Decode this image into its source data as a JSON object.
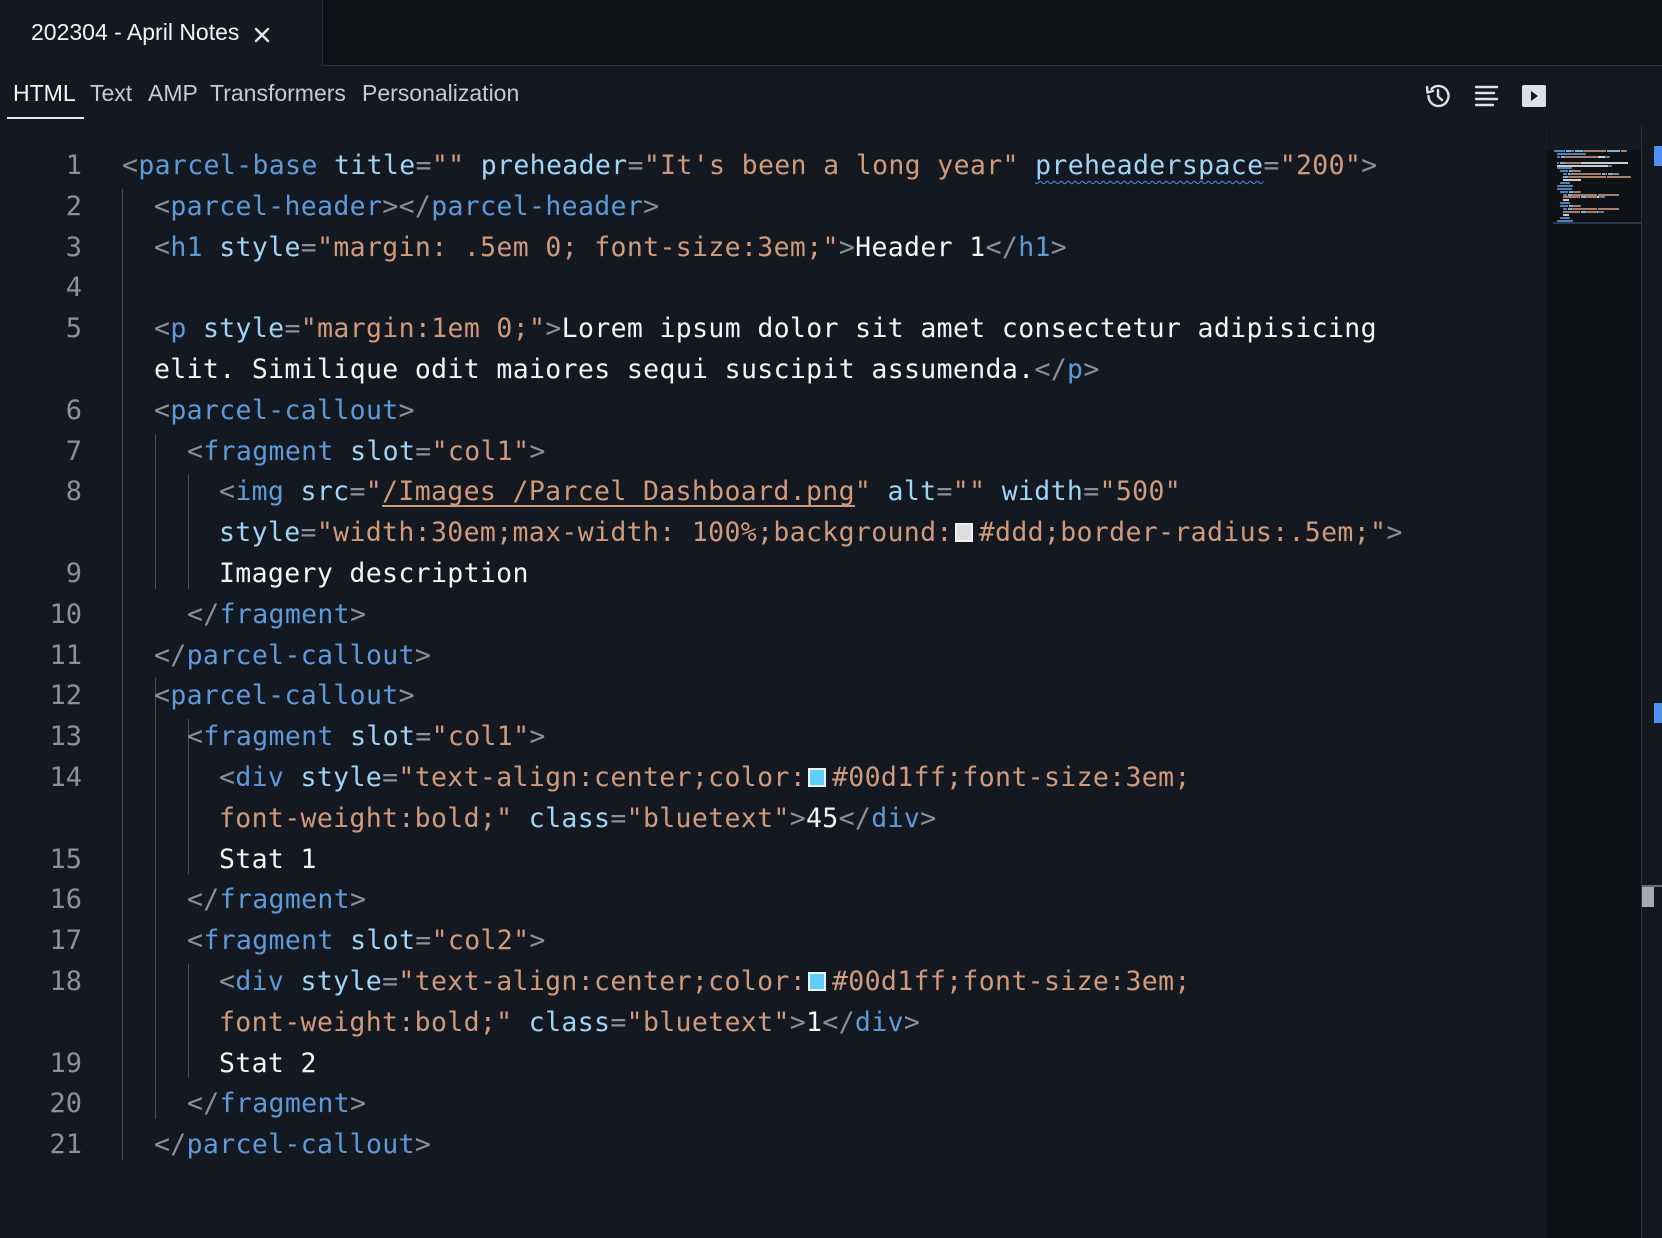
{
  "window": {
    "file_tab": {
      "title": "202304 - April Notes",
      "close_icon": "close-icon"
    }
  },
  "toolbar": {
    "tabs": [
      {
        "label": "HTML",
        "active": true
      },
      {
        "label": "Text",
        "active": false
      },
      {
        "label": "AMP",
        "active": false
      },
      {
        "label": "Transformers",
        "active": false
      },
      {
        "label": "Personalization",
        "active": false
      }
    ],
    "actions": [
      {
        "icon": "history-icon",
        "label": "History"
      },
      {
        "icon": "format-icon",
        "label": "Format"
      },
      {
        "icon": "preview-icon",
        "label": "Preview"
      }
    ]
  },
  "colors": {
    "swatch_ddd": "#dddddd",
    "swatch_00d1ff": "#5ccfff",
    "accent": "#4f8ff0"
  },
  "editor": {
    "gutter": [
      "1",
      "2",
      "3",
      "4",
      "5",
      "",
      "6",
      "7",
      "8",
      "",
      "9",
      "10",
      "11",
      "12",
      "13",
      "14",
      "",
      "15",
      "16",
      "17",
      "18",
      "",
      "19",
      "20",
      "21"
    ],
    "lines": [
      [
        [
          "p",
          "<"
        ],
        [
          "g",
          "parcel-base"
        ],
        [
          "x",
          " "
        ],
        [
          "a",
          "title"
        ],
        [
          "e",
          "="
        ],
        [
          "s",
          "\"\""
        ],
        [
          "x",
          " "
        ],
        [
          "a",
          "preheader"
        ],
        [
          "e",
          "="
        ],
        [
          "s",
          "\"It's been a long year\""
        ],
        [
          "x",
          " "
        ],
        [
          "aw",
          "preheaderspace"
        ],
        [
          "e",
          "="
        ],
        [
          "s",
          "\"200\""
        ],
        [
          "p",
          ">"
        ]
      ],
      [
        [
          "p",
          "<"
        ],
        [
          "g",
          "parcel-header"
        ],
        [
          "p",
          "></"
        ],
        [
          "g",
          "parcel-header"
        ],
        [
          "p",
          ">"
        ]
      ],
      [
        [
          "p",
          "<"
        ],
        [
          "g",
          "h1"
        ],
        [
          "x",
          " "
        ],
        [
          "a",
          "style"
        ],
        [
          "e",
          "="
        ],
        [
          "s",
          "\"margin: .5em 0; font-size:3em;\""
        ],
        [
          "p",
          ">"
        ],
        [
          "t",
          "Header 1"
        ],
        [
          "p",
          "</"
        ],
        [
          "g",
          "h1"
        ],
        [
          "p",
          ">"
        ]
      ],
      [],
      [
        [
          "p",
          "<"
        ],
        [
          "g",
          "p"
        ],
        [
          "x",
          " "
        ],
        [
          "a",
          "style"
        ],
        [
          "e",
          "="
        ],
        [
          "s",
          "\"margin:1em 0;\""
        ],
        [
          "p",
          ">"
        ],
        [
          "t",
          "Lorem ipsum dolor sit amet consectetur adipisicing"
        ]
      ],
      [
        [
          "t",
          "elit. Similique odit maiores sequi suscipit assumenda."
        ],
        [
          "p",
          "</"
        ],
        [
          "g",
          "p"
        ],
        [
          "p",
          ">"
        ]
      ],
      [
        [
          "p",
          "<"
        ],
        [
          "g",
          "parcel-callout"
        ],
        [
          "p",
          ">"
        ]
      ],
      [
        [
          "p",
          "<"
        ],
        [
          "g",
          "fragment"
        ],
        [
          "x",
          " "
        ],
        [
          "a",
          "slot"
        ],
        [
          "e",
          "="
        ],
        [
          "s",
          "\"col1\""
        ],
        [
          "p",
          ">"
        ]
      ],
      [
        [
          "p",
          "<"
        ],
        [
          "g",
          "img"
        ],
        [
          "x",
          " "
        ],
        [
          "a",
          "src"
        ],
        [
          "e",
          "="
        ],
        [
          "s",
          "\""
        ],
        [
          "sl",
          "/Images /Parcel Dashboard.png"
        ],
        [
          "s",
          "\""
        ],
        [
          "x",
          " "
        ],
        [
          "a",
          "alt"
        ],
        [
          "e",
          "="
        ],
        [
          "s",
          "\"\""
        ],
        [
          "x",
          " "
        ],
        [
          "a",
          "width"
        ],
        [
          "e",
          "="
        ],
        [
          "s",
          "\"500\""
        ]
      ],
      [
        [
          "a",
          "style"
        ],
        [
          "e",
          "="
        ],
        [
          "s",
          "\"width:30em;max-width: 100%;background:"
        ],
        [
          "sw",
          "#dddddd"
        ],
        [
          "s",
          "#ddd;border-radius:.5em;\""
        ],
        [
          "p",
          ">"
        ]
      ],
      [
        [
          "t",
          "Imagery description"
        ]
      ],
      [
        [
          "p",
          "</"
        ],
        [
          "g",
          "fragment"
        ],
        [
          "p",
          ">"
        ]
      ],
      [
        [
          "p",
          "</"
        ],
        [
          "g",
          "parcel-callout"
        ],
        [
          "p",
          ">"
        ]
      ],
      [
        [
          "p",
          "<"
        ],
        [
          "g",
          "parcel-callout"
        ],
        [
          "p",
          ">"
        ]
      ],
      [
        [
          "p",
          "<"
        ],
        [
          "g",
          "fragment"
        ],
        [
          "x",
          " "
        ],
        [
          "a",
          "slot"
        ],
        [
          "e",
          "="
        ],
        [
          "s",
          "\"col1\""
        ],
        [
          "p",
          ">"
        ]
      ],
      [
        [
          "p",
          "<"
        ],
        [
          "g",
          "div"
        ],
        [
          "x",
          " "
        ],
        [
          "a",
          "style"
        ],
        [
          "e",
          "="
        ],
        [
          "s",
          "\"text-align:center;color:"
        ],
        [
          "sw",
          "#5ccfff"
        ],
        [
          "s",
          "#00d1ff;font-size:3em;"
        ]
      ],
      [
        [
          "s",
          "font-weight:bold;\""
        ],
        [
          "x",
          " "
        ],
        [
          "a",
          "class"
        ],
        [
          "e",
          "="
        ],
        [
          "s",
          "\"bluetext\""
        ],
        [
          "p",
          ">"
        ],
        [
          "t",
          "45"
        ],
        [
          "p",
          "</"
        ],
        [
          "g",
          "div"
        ],
        [
          "p",
          ">"
        ]
      ],
      [
        [
          "t",
          "Stat 1"
        ]
      ],
      [
        [
          "p",
          "</"
        ],
        [
          "g",
          "fragment"
        ],
        [
          "p",
          ">"
        ]
      ],
      [
        [
          "p",
          "<"
        ],
        [
          "g",
          "fragment"
        ],
        [
          "x",
          " "
        ],
        [
          "a",
          "slot"
        ],
        [
          "e",
          "="
        ],
        [
          "s",
          "\"col2\""
        ],
        [
          "p",
          ">"
        ]
      ],
      [
        [
          "p",
          "<"
        ],
        [
          "g",
          "div"
        ],
        [
          "x",
          " "
        ],
        [
          "a",
          "style"
        ],
        [
          "e",
          "="
        ],
        [
          "s",
          "\"text-align:center;color:"
        ],
        [
          "sw",
          "#5ccfff"
        ],
        [
          "s",
          "#00d1ff;font-size:3em;"
        ]
      ],
      [
        [
          "s",
          "font-weight:bold;\""
        ],
        [
          "x",
          " "
        ],
        [
          "a",
          "class"
        ],
        [
          "e",
          "="
        ],
        [
          "s",
          "\"bluetext\""
        ],
        [
          "p",
          ">"
        ],
        [
          "t",
          "1"
        ],
        [
          "p",
          "</"
        ],
        [
          "g",
          "div"
        ],
        [
          "p",
          ">"
        ]
      ],
      [
        [
          "t",
          "Stat 2"
        ]
      ],
      [
        [
          "p",
          "</"
        ],
        [
          "g",
          "fragment"
        ],
        [
          "p",
          ">"
        ]
      ],
      [
        [
          "p",
          "</"
        ],
        [
          "g",
          "parcel-callout"
        ],
        [
          "p",
          ">"
        ]
      ]
    ]
  }
}
